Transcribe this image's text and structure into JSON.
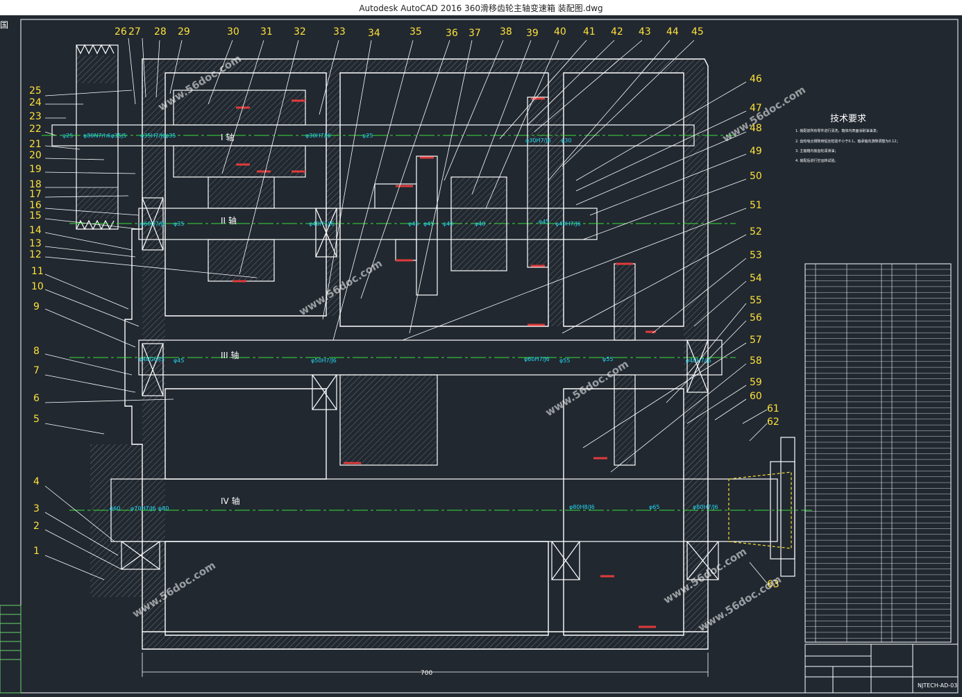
{
  "window": {
    "title": "Autodesk AutoCAD 2016     360滑移齿轮主轴变速箱 装配图.dwg"
  },
  "left_edge_label": "国",
  "shaft_labels": [
    "I 轴",
    "II 轴",
    "III 轴",
    "IV 轴"
  ],
  "top_callouts": [
    "26",
    "27",
    "28",
    "29",
    "30",
    "31",
    "32",
    "33",
    "34",
    "35",
    "36",
    "37",
    "38",
    "39",
    "40",
    "41",
    "42",
    "43",
    "44",
    "45"
  ],
  "left_callouts": [
    "25",
    "24",
    "23",
    "22",
    "21",
    "20",
    "19",
    "18",
    "17",
    "16",
    "15",
    "14",
    "13",
    "12",
    "11",
    "10",
    "9",
    "8",
    "7",
    "6",
    "5",
    "4",
    "3",
    "2",
    "1"
  ],
  "right_callouts": [
    "46",
    "47",
    "48",
    "49",
    "50",
    "51",
    "52",
    "53",
    "54",
    "55",
    "56",
    "57",
    "58",
    "59",
    "60",
    "61",
    "62",
    "63"
  ],
  "dimension_labels": [
    "φ25",
    "φ80N7/h6φ35J5",
    "φ35H7/J6",
    "φ35",
    "φ30H7/J6",
    "φ25",
    "φ30H7/J6",
    "φ30",
    "φ60G7/J6",
    "φ35",
    "φ40H7/J6",
    "φ45",
    "φ45",
    "φ40",
    "φ40",
    "φ45",
    "φ40H7/J6",
    "φ40G6/J5",
    "φ45",
    "φ50H7/J6",
    "φ60H7/J6",
    "φ55",
    "φ55",
    "φ40H7/J6",
    "φ70H7/J6",
    "φ80",
    "φ60",
    "φ80H8/J6",
    "φ65",
    "φ80H7/J6"
  ],
  "overall_dimension": "700",
  "tech_requirements": {
    "title": "技术要求",
    "items": [
      "1. 装配前所有零件进行清洗，箱体内表面涂耐油油漆；",
      "2. 齿轮啮合侧隙用铅丝检验不小于0.1，轴承轴向游隙调整为0.12；",
      "3. 主轴箱内装齿轮润滑油；",
      "4. 装配后进行空运转试验。"
    ]
  },
  "title_block": {
    "drawing_number": "NJTECH-AD-03"
  },
  "watermark": "www.56doc.com"
}
